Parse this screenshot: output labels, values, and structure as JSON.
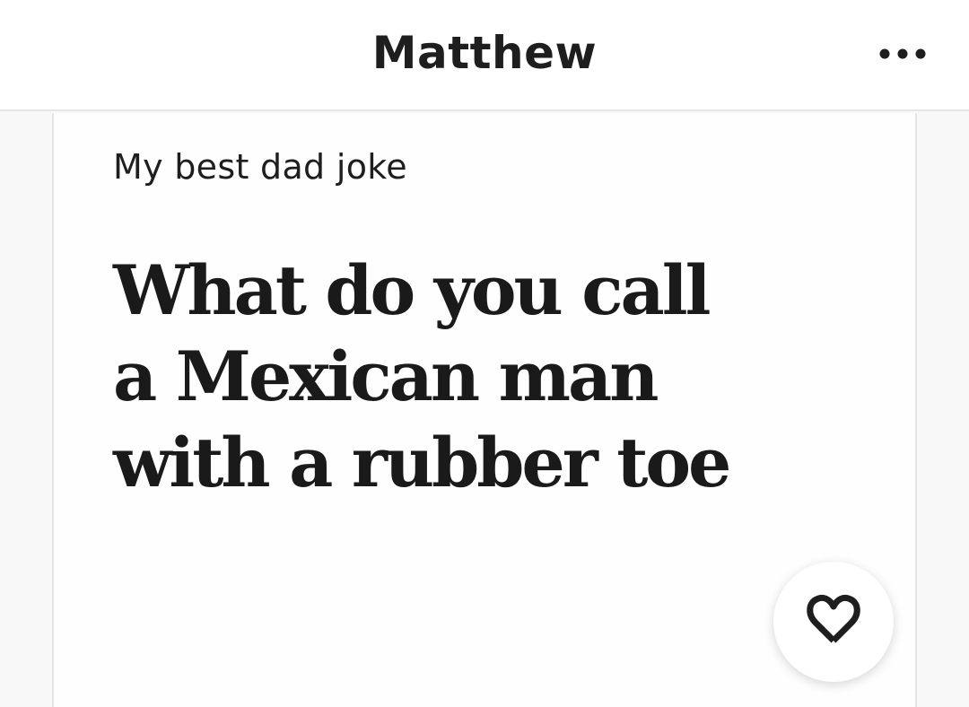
{
  "header": {
    "title": "Matthew",
    "menu_icon": "more-horizontal-icon"
  },
  "card": {
    "prompt": "My best dad joke",
    "answer": "What do you call\na Mexican man\nwith a rubber toe",
    "like_icon": "heart-outline-icon"
  },
  "colors": {
    "background": "#f8f8f8",
    "surface": "#ffffff",
    "text": "#1e1e1e",
    "divider": "#e6e6e6"
  }
}
